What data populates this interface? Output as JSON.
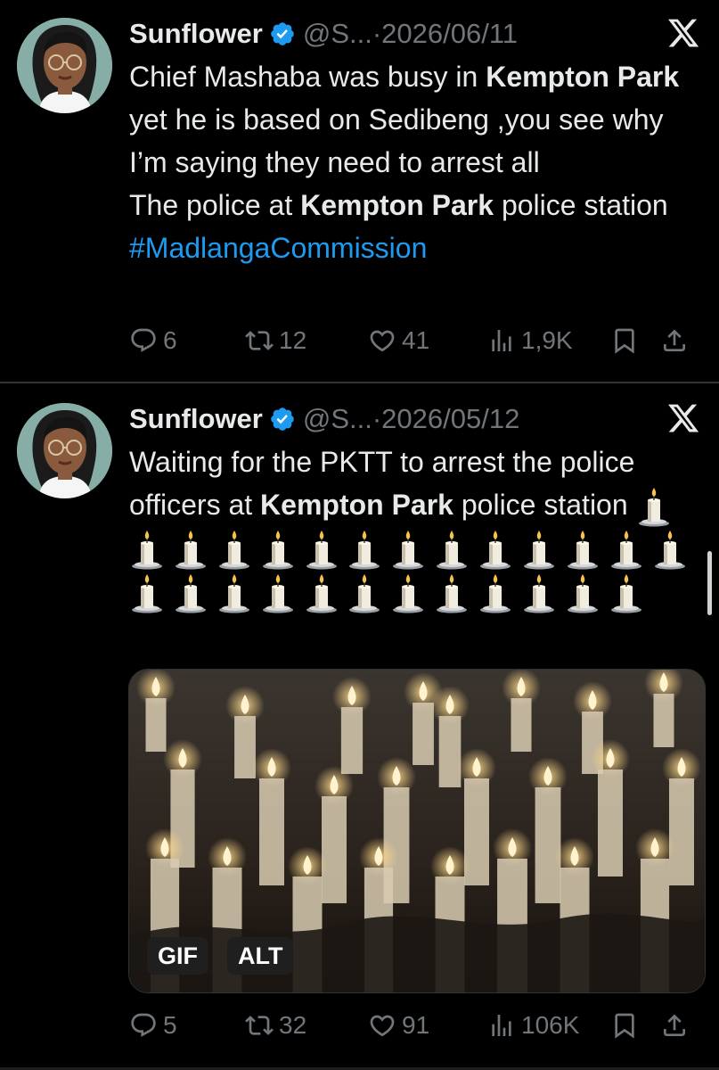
{
  "tweets": [
    {
      "author": {
        "name": "Sunflower",
        "handle": "@S...",
        "verified": true
      },
      "separator": "·",
      "date": "2026/06/11",
      "text": {
        "p1": "Chief Mashaba was busy in ",
        "b1": "Kempton Park",
        "p2": " yet he is based on Sedibeng ,you see why I’m saying they need to arrest all",
        "p3": "The police at ",
        "b2": "Kempton Park",
        "p4": " police station ",
        "hashtag": "#MadlangaCommission"
      },
      "actions": {
        "replies": "6",
        "reposts": "12",
        "likes": "41",
        "views": "1,9K"
      }
    },
    {
      "author": {
        "name": "Sunflower",
        "handle": "@S...",
        "verified": true
      },
      "separator": "·",
      "date": "2026/05/12",
      "text": {
        "p1": "Waiting for the PKTT to arrest the police officers at ",
        "b1": "Kempton Park",
        "p2": " police station",
        "emoji": "🕯",
        "emoji_count": 26
      },
      "media": {
        "type": "GIF",
        "badges": {
          "gif": "GIF",
          "alt": "ALT"
        }
      },
      "actions": {
        "replies": "5",
        "reposts": "32",
        "likes": "91",
        "views": "106K"
      }
    }
  ],
  "icons": {
    "reply": "reply-icon",
    "repost": "repost-icon",
    "like": "like-icon",
    "views": "views-icon",
    "bookmark": "bookmark-icon",
    "share": "share-icon",
    "verified": "verified-badge-icon",
    "platform": "x-logo-icon"
  },
  "colors": {
    "background": "#000000",
    "text": "#e7e9ea",
    "secondary": "#71767b",
    "link": "#1d9bf0",
    "verified": "#1d9bf0"
  }
}
